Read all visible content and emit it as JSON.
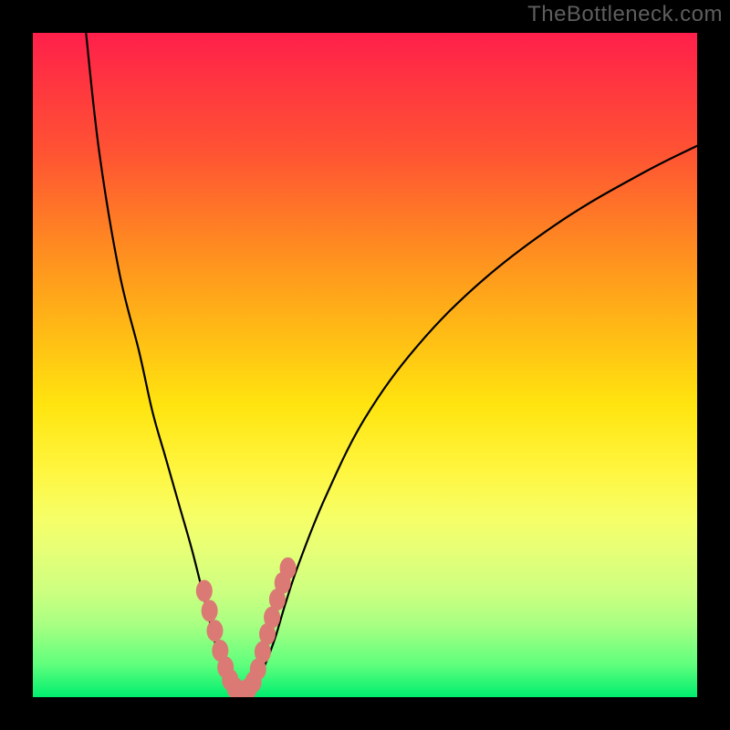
{
  "watermark": "TheBottleneck.com",
  "chart_data": {
    "type": "line",
    "title": "",
    "xlabel": "",
    "ylabel": "",
    "xlim": [
      0,
      100
    ],
    "ylim": [
      0,
      100
    ],
    "grid": false,
    "legend": false,
    "note": "V-shaped bottleneck curve; background gradient encodes bottleneck severity (red=high, green=low). Beaded segments highlight a specific hardware range near the minimum.",
    "series": [
      {
        "name": "left-branch",
        "x": [
          8,
          10,
          13,
          16,
          18,
          20,
          22,
          24,
          26,
          27.5,
          29,
          30,
          30.8
        ],
        "values": [
          100,
          82,
          64,
          52,
          43,
          36,
          29,
          22,
          14,
          8,
          4,
          1.5,
          0.8
        ]
      },
      {
        "name": "right-branch",
        "x": [
          32,
          33.5,
          35,
          36.5,
          38,
          40,
          44,
          50,
          58,
          68,
          80,
          92,
          100
        ],
        "values": [
          0.8,
          2,
          5,
          9,
          14,
          20,
          30,
          42,
          53,
          63,
          72,
          79,
          83
        ]
      },
      {
        "name": "bottom-flat",
        "x": [
          30.8,
          31.4,
          32
        ],
        "values": [
          0.8,
          0.7,
          0.8
        ]
      }
    ],
    "markers": {
      "name": "beads",
      "color": "#db7a74",
      "points": [
        {
          "x": 25.8,
          "y": 16
        },
        {
          "x": 26.6,
          "y": 13
        },
        {
          "x": 27.4,
          "y": 10
        },
        {
          "x": 28.2,
          "y": 7
        },
        {
          "x": 29.0,
          "y": 4.5
        },
        {
          "x": 29.7,
          "y": 2.6
        },
        {
          "x": 30.4,
          "y": 1.4
        },
        {
          "x": 31.1,
          "y": 0.9
        },
        {
          "x": 31.8,
          "y": 0.9
        },
        {
          "x": 32.5,
          "y": 1.3
        },
        {
          "x": 33.2,
          "y": 2.3
        },
        {
          "x": 33.9,
          "y": 4.2
        },
        {
          "x": 34.6,
          "y": 6.8
        },
        {
          "x": 35.3,
          "y": 9.5
        },
        {
          "x": 36.0,
          "y": 12
        },
        {
          "x": 36.8,
          "y": 14.7
        },
        {
          "x": 37.6,
          "y": 17.2
        },
        {
          "x": 38.4,
          "y": 19.4
        }
      ]
    },
    "gradient_stops": [
      {
        "pos": 0.0,
        "color": "#ff1f4b"
      },
      {
        "pos": 0.18,
        "color": "#ff5333"
      },
      {
        "pos": 0.44,
        "color": "#ffb716"
      },
      {
        "pos": 0.66,
        "color": "#fff640"
      },
      {
        "pos": 0.84,
        "color": "#cdff80"
      },
      {
        "pos": 1.0,
        "color": "#00ee6e"
      }
    ]
  }
}
